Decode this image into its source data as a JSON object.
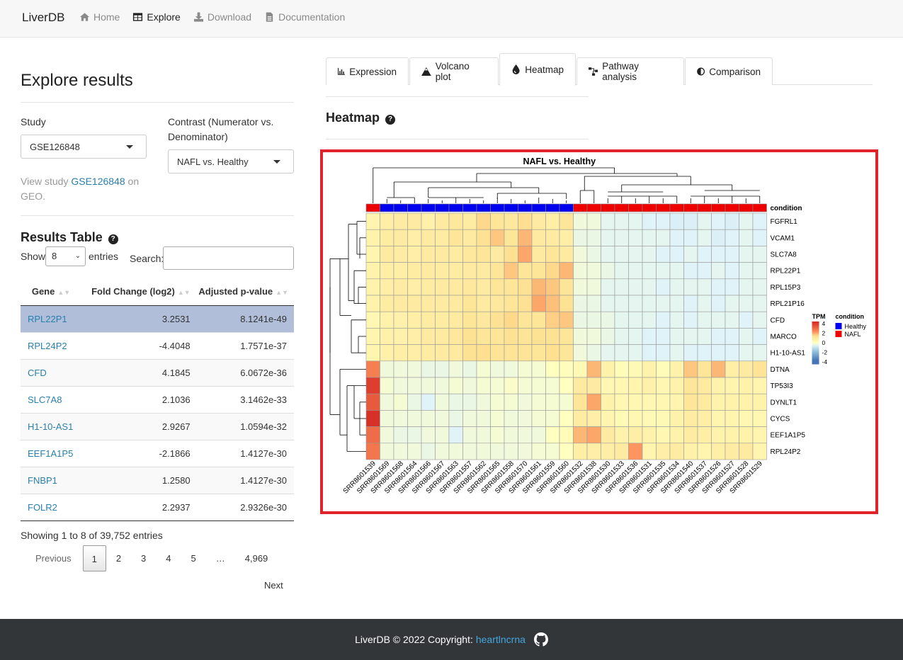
{
  "navbar": {
    "brand": "LiverDB",
    "links": [
      {
        "label": "Home",
        "icon": "home-icon",
        "active": false
      },
      {
        "label": "Explore",
        "icon": "table-icon",
        "active": true
      },
      {
        "label": "Download",
        "icon": "download-icon",
        "active": false
      },
      {
        "label": "Documentation",
        "icon": "file-icon",
        "active": false
      }
    ]
  },
  "left": {
    "title": "Explore results",
    "study_label": "Study",
    "study_value": "GSE126848",
    "contrast_label_1": "Contrast (Numerator vs.",
    "contrast_label_2": "Denominator)",
    "contrast_value": "NAFL vs. Healthy",
    "view_study_pre": "View study",
    "view_study_link": "GSE126848",
    "view_study_post": "on",
    "view_study_geo": "GEO.",
    "results_title": "Results Table",
    "show_label": "Show",
    "entries_value": "8",
    "entries_label": "entries",
    "search_label": "Search:",
    "search_value": "",
    "columns": [
      "Gene",
      "Fold Change (log2)",
      "Adjusted p-value"
    ],
    "rows": [
      {
        "gene": "RPL22P1",
        "fc": "3.2531",
        "p": "8.1241e-49"
      },
      {
        "gene": "RPL24P2",
        "fc": "-4.4048",
        "p": "1.7571e-37"
      },
      {
        "gene": "CFD",
        "fc": "4.1845",
        "p": "6.0672e-36"
      },
      {
        "gene": "SLC7A8",
        "fc": "2.1036",
        "p": "3.1462e-33"
      },
      {
        "gene": "H1-10-AS1",
        "fc": "2.9267",
        "p": "1.0594e-32"
      },
      {
        "gene": "EEF1A1P5",
        "fc": "-2.1866",
        "p": "1.4127e-30"
      },
      {
        "gene": "FNBP1",
        "fc": "1.2580",
        "p": "1.4127e-30"
      },
      {
        "gene": "FOLR2",
        "fc": "2.2937",
        "p": "2.9326e-30"
      }
    ],
    "showing": "Showing 1 to 8 of 39,752 entries",
    "pager": {
      "previous": "Previous",
      "pages": [
        "1",
        "2",
        "3",
        "4",
        "5"
      ],
      "ellipsis": "…",
      "last": "4,969",
      "next": "Next",
      "current": "1"
    }
  },
  "tabs": [
    {
      "label": "Expression",
      "icon": "bar-chart-icon"
    },
    {
      "label": "Volcano plot",
      "icon": "mountain-icon"
    },
    {
      "label": "Heatmap",
      "icon": "drop-icon",
      "active": true
    },
    {
      "label": "Pathway analysis",
      "icon": "sitemap-icon"
    },
    {
      "label": "Comparison",
      "icon": "adjust-icon"
    }
  ],
  "section_title": "Heatmap",
  "chart_data": {
    "type": "heatmap",
    "title": "NAFL vs. Healthy",
    "samples": [
      "SRR8601539",
      "SRR8601569",
      "SRR8601568",
      "SRR8601564",
      "SRR8601566",
      "SRR8601567",
      "SRR8601563",
      "SRR8601557",
      "SRR8601562",
      "SRR8601565",
      "SRR8601558",
      "SRR8601570",
      "SRR8601561",
      "SRR8601559",
      "SRR8601560",
      "SRR8601532",
      "SRR8601538",
      "SRR8601530",
      "SRR8601533",
      "SRR8601536",
      "SRR8601531",
      "SRR8601535",
      "SRR8601534",
      "SRR8601540",
      "SRR8601537",
      "SRR8601526",
      "SRR8601527",
      "SRR8601528",
      "SRR8601529"
    ],
    "condition": [
      "NAFL",
      "Healthy",
      "Healthy",
      "Healthy",
      "Healthy",
      "Healthy",
      "Healthy",
      "Healthy",
      "Healthy",
      "Healthy",
      "Healthy",
      "Healthy",
      "Healthy",
      "Healthy",
      "Healthy",
      "NAFL",
      "NAFL",
      "NAFL",
      "NAFL",
      "NAFL",
      "NAFL",
      "NAFL",
      "NAFL",
      "NAFL",
      "NAFL",
      "NAFL",
      "NAFL",
      "NAFL",
      "NAFL"
    ],
    "genes": [
      "FGFRL1",
      "VCAM1",
      "SLC7A8",
      "RPL22P1",
      "RPL15P3",
      "RPL21P16",
      "CFD",
      "MARCO",
      "H1-10-AS1",
      "DTNA",
      "TP53I3",
      "DYNLT1",
      "CYCS",
      "EEF1A1P5",
      "RPL24P2"
    ],
    "values": [
      [
        0.5,
        0.8,
        0.9,
        1.0,
        0.7,
        1.0,
        1.1,
        0.9,
        1.6,
        1.2,
        1.1,
        1.5,
        1.0,
        0.8,
        1.2,
        -0.3,
        -0.3,
        -0.5,
        -0.5,
        -0.5,
        -0.6,
        -0.6,
        -0.7,
        -0.7,
        -0.5,
        -0.6,
        -0.7,
        -0.5,
        -0.6
      ],
      [
        0.6,
        0.9,
        1.0,
        0.8,
        1.0,
        0.9,
        1.2,
        1.0,
        1.4,
        1.8,
        1.2,
        2.0,
        1.0,
        1.0,
        0.8,
        -0.4,
        -0.4,
        -0.5,
        -0.5,
        -0.5,
        -0.5,
        -0.5,
        -0.6,
        -0.6,
        -0.5,
        -0.7,
        -0.6,
        -0.5,
        -0.6
      ],
      [
        0.5,
        1.0,
        0.9,
        0.8,
        1.0,
        1.0,
        0.9,
        1.1,
        1.2,
        1.0,
        1.5,
        2.2,
        1.0,
        1.2,
        1.0,
        -0.3,
        -0.4,
        -0.5,
        -0.5,
        -0.5,
        -0.5,
        -0.6,
        -0.6,
        -0.5,
        -0.6,
        -0.6,
        -0.6,
        -0.5,
        -0.5
      ],
      [
        0.6,
        0.8,
        0.8,
        0.9,
        1.0,
        0.9,
        0.9,
        1.0,
        1.0,
        1.2,
        1.8,
        1.2,
        1.2,
        1.6,
        2.0,
        -0.3,
        -0.3,
        -0.4,
        -0.5,
        -0.5,
        -0.5,
        -0.5,
        -0.5,
        -0.6,
        -0.6,
        -0.5,
        -0.6,
        -0.5,
        -0.5
      ],
      [
        0.6,
        0.8,
        0.9,
        0.8,
        0.9,
        1.0,
        1.0,
        1.1,
        1.0,
        1.2,
        1.2,
        1.4,
        2.0,
        1.8,
        1.3,
        -0.3,
        -0.3,
        -0.5,
        -0.5,
        -0.5,
        -0.5,
        -0.6,
        -0.5,
        -0.5,
        -0.5,
        -0.6,
        -0.6,
        -0.5,
        -0.5
      ],
      [
        0.6,
        0.9,
        1.0,
        1.0,
        1.0,
        1.0,
        1.0,
        1.2,
        1.0,
        1.1,
        1.2,
        1.4,
        2.2,
        1.9,
        1.4,
        -0.4,
        -0.4,
        -0.5,
        -0.5,
        -0.5,
        -0.5,
        -0.5,
        -0.5,
        -0.6,
        -0.5,
        -0.6,
        -0.5,
        -0.5,
        -0.5
      ],
      [
        0.4,
        0.6,
        0.7,
        0.8,
        0.9,
        0.9,
        1.0,
        1.2,
        1.1,
        1.4,
        1.6,
        1.2,
        1.2,
        1.7,
        1.8,
        -0.4,
        -0.4,
        -0.4,
        -0.5,
        -0.5,
        -0.5,
        -0.6,
        -0.5,
        -0.6,
        -0.5,
        -0.5,
        -0.5,
        -0.6,
        -0.5
      ],
      [
        0.5,
        0.7,
        0.7,
        0.8,
        1.0,
        1.0,
        1.1,
        1.4,
        1.2,
        1.2,
        1.4,
        1.3,
        1.4,
        1.4,
        1.2,
        -0.3,
        -0.3,
        -0.4,
        -0.5,
        -0.5,
        -0.6,
        -0.6,
        -0.5,
        -0.5,
        -0.5,
        -0.6,
        -0.6,
        -0.5,
        -0.6
      ],
      [
        0.5,
        0.7,
        0.8,
        0.8,
        0.9,
        1.0,
        1.0,
        1.4,
        1.5,
        1.3,
        1.3,
        1.3,
        1.2,
        1.5,
        1.2,
        -0.3,
        -0.4,
        -0.5,
        -0.5,
        -0.5,
        -0.6,
        -0.6,
        -0.5,
        -0.6,
        -0.6,
        -0.6,
        -0.6,
        -0.5,
        -0.5
      ],
      [
        2.8,
        -0.3,
        -0.3,
        -0.3,
        -0.4,
        -0.4,
        -0.3,
        -0.4,
        -0.2,
        -0.3,
        -0.3,
        -0.2,
        -0.2,
        0.0,
        0.1,
        0.3,
        2.0,
        0.6,
        0.2,
        0.3,
        0.6,
        0.2,
        0.6,
        1.8,
        1.2,
        2.0,
        0.8,
        1.0,
        1.3
      ],
      [
        4.2,
        -0.2,
        -0.3,
        -0.3,
        -0.3,
        -0.3,
        -0.2,
        -0.3,
        -0.2,
        -0.2,
        -0.1,
        -0.2,
        -0.2,
        -0.2,
        0.0,
        1.0,
        1.0,
        0.4,
        0.4,
        0.5,
        0.7,
        0.4,
        0.6,
        1.2,
        1.0,
        0.6,
        0.5,
        0.6,
        0.5
      ],
      [
        3.6,
        -0.3,
        -0.2,
        -0.4,
        -0.6,
        -0.3,
        -0.4,
        -0.4,
        -0.3,
        -0.2,
        -0.2,
        -0.3,
        -0.2,
        -0.2,
        -0.2,
        1.2,
        2.2,
        0.6,
        0.4,
        0.4,
        0.4,
        0.4,
        0.5,
        1.2,
        1.0,
        0.6,
        0.6,
        0.6,
        0.6
      ],
      [
        4.6,
        -0.3,
        -0.3,
        -0.3,
        -0.3,
        -0.3,
        -0.4,
        -0.3,
        -0.3,
        -0.2,
        -0.3,
        -0.3,
        -0.2,
        -0.2,
        0.0,
        0.9,
        0.8,
        0.5,
        0.3,
        0.4,
        0.3,
        0.3,
        0.6,
        0.9,
        0.8,
        0.5,
        0.5,
        0.4,
        0.4
      ],
      [
        3.2,
        -0.3,
        -0.4,
        -0.4,
        -0.3,
        -0.3,
        -0.6,
        -0.3,
        -0.3,
        -0.2,
        -0.3,
        -0.3,
        -0.3,
        0.0,
        0.2,
        2.0,
        2.2,
        1.0,
        0.6,
        0.8,
        0.6,
        0.4,
        0.6,
        0.9,
        0.8,
        0.6,
        0.6,
        0.6,
        0.5
      ],
      [
        3.0,
        -0.3,
        -0.3,
        -0.3,
        -0.4,
        -0.3,
        -0.3,
        -0.3,
        -0.3,
        -0.3,
        -0.3,
        -0.3,
        -0.2,
        -0.2,
        0.0,
        0.8,
        0.8,
        0.8,
        1.0,
        2.4,
        0.5,
        0.8,
        0.9,
        0.7,
        0.5,
        0.8,
        0.9,
        1.0,
        0.5
      ]
    ],
    "legend_title": "TPM",
    "scale_ticks": [
      "4",
      "2",
      "0",
      "-2",
      "-4"
    ],
    "condition_legend_title": "condition",
    "condition_legend": [
      {
        "label": "Healthy",
        "color": "#0000ee"
      },
      {
        "label": "NAFL",
        "color": "#ee0000"
      }
    ],
    "annotation_label": "condition"
  },
  "footer": {
    "text": "LiverDB © 2022 Copyright:",
    "link": "heartlncrna",
    "icon": "github-icon"
  }
}
